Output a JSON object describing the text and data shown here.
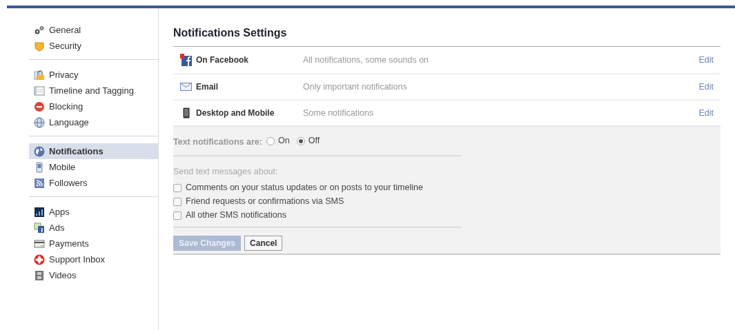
{
  "sidebar": {
    "groups": [
      {
        "items": [
          {
            "label": "General",
            "kind": "gears",
            "selected": false
          },
          {
            "label": "Security",
            "kind": "badge",
            "selected": false
          }
        ]
      },
      {
        "items": [
          {
            "label": "Privacy",
            "kind": "lock",
            "selected": false
          },
          {
            "label": "Timeline and Tagging",
            "kind": "timeline",
            "selected": false
          },
          {
            "label": "Blocking",
            "kind": "block",
            "selected": false
          },
          {
            "label": "Language",
            "kind": "globe",
            "selected": false
          }
        ]
      },
      {
        "items": [
          {
            "label": "Notifications",
            "kind": "earth",
            "selected": true
          },
          {
            "label": "Mobile",
            "kind": "phone",
            "selected": false
          },
          {
            "label": "Followers",
            "kind": "rss",
            "selected": false
          }
        ]
      },
      {
        "items": [
          {
            "label": "Apps",
            "kind": "apps",
            "selected": false
          },
          {
            "label": "Ads",
            "kind": "ads",
            "selected": false
          },
          {
            "label": "Payments",
            "kind": "card",
            "selected": false
          },
          {
            "label": "Support Inbox",
            "kind": "lifebuoy",
            "selected": false
          },
          {
            "label": "Videos",
            "kind": "film",
            "selected": false
          }
        ]
      }
    ]
  },
  "main": {
    "title": "Notifications Settings",
    "rows": [
      {
        "label": "On Facebook",
        "kind": "facebook",
        "summary": "All notifications, some sounds on",
        "action": "Edit"
      },
      {
        "label": "Email",
        "kind": "envelope",
        "summary": "Only important notifications",
        "action": "Edit"
      },
      {
        "label": "Desktop and Mobile",
        "kind": "device",
        "summary": "Some notifications",
        "action": "Edit"
      }
    ],
    "text_notifications": {
      "label": "Text notifications are:",
      "options": [
        {
          "label": "On",
          "selected": false
        },
        {
          "label": "Off",
          "selected": true
        }
      ]
    },
    "send_about": {
      "label": "Send text messages about:",
      "options": [
        {
          "label": "Comments on your status updates or on posts to your timeline",
          "checked": false
        },
        {
          "label": "Friend requests or confirmations via SMS",
          "checked": false
        },
        {
          "label": "All other SMS notifications",
          "checked": false
        }
      ]
    },
    "buttons": [
      {
        "label": "Save Changes",
        "kind": "primary",
        "disabled": true
      },
      {
        "label": "Cancel",
        "kind": "secondary",
        "disabled": false
      }
    ]
  }
}
